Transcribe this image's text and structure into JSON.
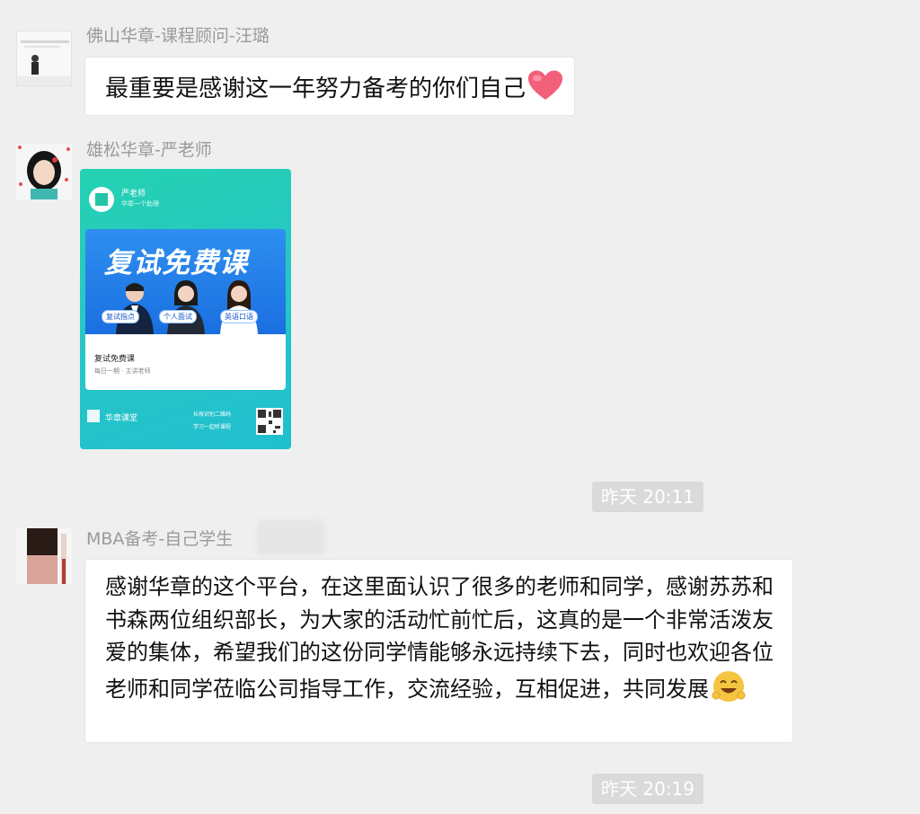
{
  "messages": [
    {
      "sender": "佛山华章-课程顾问-汪璐",
      "text": "最重要是感谢这一年努力备考的你们自己",
      "emoji": "heart-icon"
    },
    {
      "sender": "雄松华章-严老师",
      "card": {
        "name": "严老师",
        "subtitle": "华章一个助理",
        "title": "复试免费课",
        "tags": [
          "复试指点",
          "个人面试",
          "英语口语"
        ],
        "info_title": "复试免费课",
        "info_sub": "每日一期 · 主讲老师",
        "brand": "华章课堂",
        "scan_line1": "长按识别二维码",
        "scan_line2": "学习一起听课程"
      }
    },
    {
      "sender": "MBA备考-自己学生",
      "text": "感谢华章的这个平台，在这里面认识了很多的老师和同学，感谢苏苏和书森两位组织部长，为大家的活动忙前忙后，这真的是一个非常活泼友爱的集体，希望我们的这份同学情能够永远持续下去，同时也欢迎各位老师和同学莅临公司指导工作，交流经验，互相促进，共同发展",
      "emoji": "happy-face-icon"
    }
  ],
  "timestamps": [
    "昨天 20:11",
    "昨天 20:19"
  ],
  "colors": {
    "background": "#efefef",
    "bubble": "#ffffff",
    "card_teal": "#24d2b0",
    "card_blue": "#1a6fe0"
  }
}
